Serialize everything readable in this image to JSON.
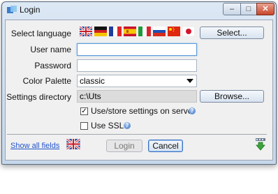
{
  "window": {
    "title": "Login"
  },
  "titlebar": {
    "min_glyph": "–",
    "max_glyph": "□",
    "close_glyph": "✕"
  },
  "form": {
    "language_label": "Select language",
    "select_button": "Select...",
    "username_label": "User name",
    "username_value": "",
    "password_label": "Password",
    "password_value": "",
    "palette_label": "Color Palette",
    "palette_value": "classic",
    "settings_dir_label": "Settings directory",
    "settings_dir_value": "c:\\Uts",
    "browse_button": "Browse...",
    "store_settings_label": "Use/store settings on server",
    "store_settings_checked": true,
    "ssl_label": "Use SSL",
    "ssl_checked": false
  },
  "footer": {
    "show_all_link": "Show all fields",
    "login_button": "Login",
    "cancel_button": "Cancel"
  },
  "flags": [
    "english-uk-us-flag",
    "german-flag",
    "french-flag",
    "spanish-flag",
    "italian-flag",
    "russian-flag",
    "chinese-flag",
    "japanese-flag"
  ],
  "icons": {
    "app": "login-app-icon",
    "help": "help-icon",
    "flag_footer": "english-uk-us-flag",
    "download": "download-arrow-icon"
  }
}
